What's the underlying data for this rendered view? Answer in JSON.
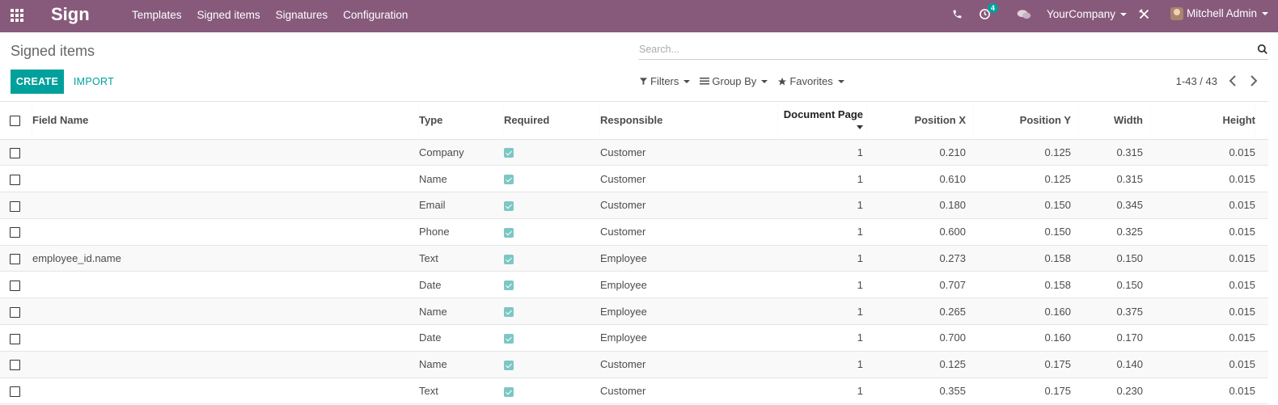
{
  "navbar": {
    "brand": "Sign",
    "menu": [
      "Templates",
      "Signed items",
      "Signatures",
      "Configuration"
    ],
    "activity_badge": "4",
    "company": "YourCompany",
    "user": "Mitchell Admin"
  },
  "control_panel": {
    "title": "Signed items",
    "create_label": "CREATE",
    "import_label": "IMPORT",
    "search_placeholder": "Search...",
    "filters_label": "Filters",
    "groupby_label": "Group By",
    "favorites_label": "Favorites",
    "pager": "1-43 / 43"
  },
  "table": {
    "headers": {
      "field_name": "Field Name",
      "type": "Type",
      "required": "Required",
      "responsible": "Responsible",
      "document_page": "Document Page",
      "position_x": "Position X",
      "position_y": "Position Y",
      "width": "Width",
      "height": "Height"
    },
    "rows": [
      {
        "field_name": "",
        "type": "Company",
        "responsible": "Customer",
        "page": "1",
        "x": "0.210",
        "y": "0.125",
        "w": "0.315",
        "h": "0.015"
      },
      {
        "field_name": "",
        "type": "Name",
        "responsible": "Customer",
        "page": "1",
        "x": "0.610",
        "y": "0.125",
        "w": "0.315",
        "h": "0.015"
      },
      {
        "field_name": "",
        "type": "Email",
        "responsible": "Customer",
        "page": "1",
        "x": "0.180",
        "y": "0.150",
        "w": "0.345",
        "h": "0.015"
      },
      {
        "field_name": "",
        "type": "Phone",
        "responsible": "Customer",
        "page": "1",
        "x": "0.600",
        "y": "0.150",
        "w": "0.325",
        "h": "0.015"
      },
      {
        "field_name": "employee_id.name",
        "type": "Text",
        "responsible": "Employee",
        "page": "1",
        "x": "0.273",
        "y": "0.158",
        "w": "0.150",
        "h": "0.015"
      },
      {
        "field_name": "",
        "type": "Date",
        "responsible": "Employee",
        "page": "1",
        "x": "0.707",
        "y": "0.158",
        "w": "0.150",
        "h": "0.015"
      },
      {
        "field_name": "",
        "type": "Name",
        "responsible": "Employee",
        "page": "1",
        "x": "0.265",
        "y": "0.160",
        "w": "0.375",
        "h": "0.015"
      },
      {
        "field_name": "",
        "type": "Date",
        "responsible": "Employee",
        "page": "1",
        "x": "0.700",
        "y": "0.160",
        "w": "0.170",
        "h": "0.015"
      },
      {
        "field_name": "",
        "type": "Name",
        "responsible": "Customer",
        "page": "1",
        "x": "0.125",
        "y": "0.175",
        "w": "0.140",
        "h": "0.015"
      },
      {
        "field_name": "",
        "type": "Text",
        "responsible": "Customer",
        "page": "1",
        "x": "0.355",
        "y": "0.175",
        "w": "0.230",
        "h": "0.015"
      }
    ]
  }
}
